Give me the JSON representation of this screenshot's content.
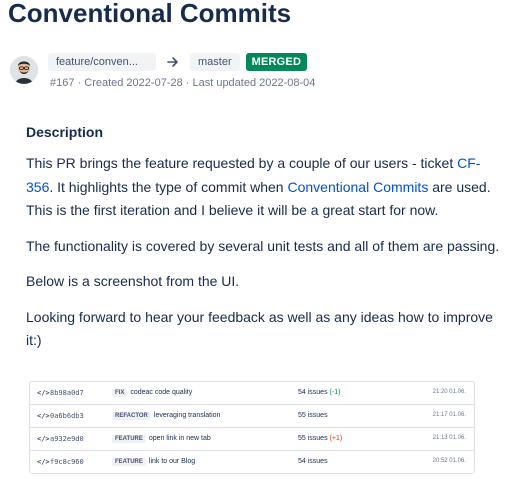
{
  "pr": {
    "title": "Conventional Commits",
    "source_branch": "feature/conven...",
    "target_branch": "master",
    "status": "MERGED",
    "meta": "#167 · Created 2022-07-28 · Last updated 2022-08-04"
  },
  "description": {
    "heading": "Description",
    "p1_a": "This PR brings the feature requested by a couple of our users - ticket ",
    "p1_link": "CF-356",
    "p1_b": ". It highlights the type of commit when ",
    "p1_link2": "Conventional Commits",
    "p1_c": " are used. This is the first iteration and I believe it will be a great start for now.",
    "p2": "The functionality is covered by several unit tests and all of them are passing.",
    "p3": "Below is a screenshot from the UI.",
    "p4": "Looking forward to hear your feedback as well as any ideas how to improve it:)"
  },
  "commits": [
    {
      "icon": "</>",
      "hash": "8b98a0d7",
      "tag": "FIX",
      "message": "codeac code quality",
      "issues": "54 issues",
      "delta": "(-1)",
      "delta_kind": "green",
      "time": "21:20 01.06."
    },
    {
      "icon": "</>",
      "hash": "0a6b6db3",
      "tag": "REFACTOR",
      "message": "leveraging translation",
      "issues": "55 issues",
      "delta": "",
      "delta_kind": "",
      "time": "21:17 01.06."
    },
    {
      "icon": "</>",
      "hash": "a932e9d0",
      "tag": "FEATURE",
      "message": "open link in new tab",
      "issues": "55 issues",
      "delta": "(+1)",
      "delta_kind": "red",
      "time": "21:13 01.06."
    },
    {
      "icon": "</>",
      "hash": "f9c8c960",
      "tag": "FEATURE",
      "message": "link to our Blog",
      "issues": "54 issues",
      "delta": "",
      "delta_kind": "",
      "time": "20:52 01.06."
    }
  ],
  "colors": {
    "merged": "#00875a",
    "link": "#0052cc",
    "text": "#172b4d"
  }
}
